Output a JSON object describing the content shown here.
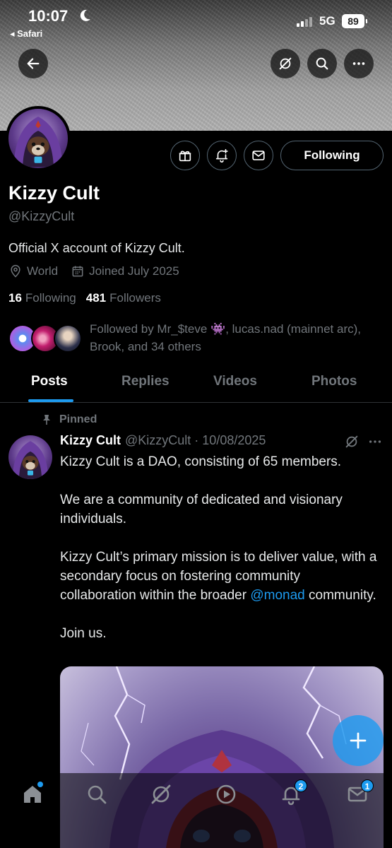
{
  "status_bar": {
    "time": "10:07",
    "back_app": "◂ Safari",
    "network": "5G",
    "battery": "89"
  },
  "profile": {
    "name": "Kizzy Cult",
    "handle": "@KizzyCult",
    "bio": "Official X account of Kizzy Cult.",
    "location": "World",
    "joined": "Joined July 2025",
    "following_count": "16",
    "following_label": "Following",
    "followers_count": "481",
    "followers_label": "Followers",
    "followed_by": "Followed by Mr_$teve 👾, lucas.nad (mainnet arc), Brook, and 34 others",
    "follow_button": "Following"
  },
  "tabs": [
    {
      "label": "Posts",
      "active": true
    },
    {
      "label": "Replies"
    },
    {
      "label": "Videos"
    },
    {
      "label": "Photos"
    }
  ],
  "post": {
    "pinned_label": "Pinned",
    "author": "Kizzy Cult",
    "handle_date": "@KizzyCult · 10/08/2025",
    "line1": "Kizzy Cult is a DAO, consisting of 65 members.",
    "line2": "We are a community of dedicated and visionary individuals.",
    "line3_prefix": "Kizzy Cult’s primary mission is to deliver value, with a secondary focus on fostering community collaboration within the broader ",
    "mention": "@monad",
    "line3_suffix": " community.",
    "line4": "Join us."
  },
  "bottom_nav": {
    "notifications_badge": "2",
    "messages_badge": "1"
  },
  "colors": {
    "accent": "#1d9bf0",
    "background": "#000000",
    "muted": "#71767b"
  }
}
